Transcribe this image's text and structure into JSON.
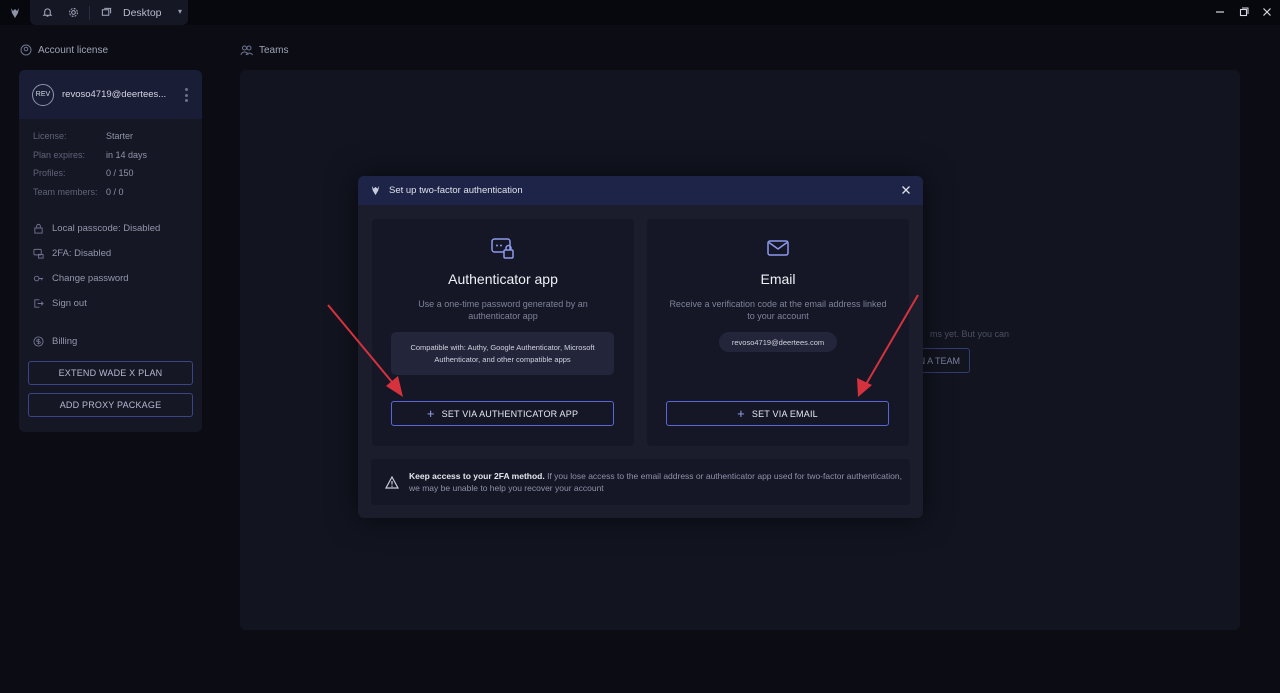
{
  "titlebar": {
    "workspace_label": "Desktop",
    "caret": "▾"
  },
  "sidebar": {
    "section_title": "Account license",
    "account": {
      "avatar_initials": "REV",
      "email": "revoso4719@deertees..."
    },
    "details": [
      {
        "label": "License:",
        "value": "Starter"
      },
      {
        "label": "Plan expires:",
        "value": "in 14 days"
      },
      {
        "label": "Profiles:",
        "value": "0 / 150"
      },
      {
        "label": "Team members:",
        "value": "0 / 0"
      }
    ],
    "links": {
      "passcode": "Local passcode: Disabled",
      "twofa": "2FA: Disabled",
      "change_password": "Change password",
      "sign_out": "Sign out",
      "billing": "Billing"
    },
    "buttons": {
      "extend": "EXTEND WADE X PLAN",
      "proxy": "ADD PROXY PACKAGE"
    }
  },
  "teams": {
    "section_title": "Teams",
    "bg_text": "ms yet. But you can",
    "bg_button": "N A TEAM"
  },
  "modal": {
    "title": "Set up two-factor authentication",
    "auth_app": {
      "title": "Authenticator app",
      "description": "Use a one-time password generated by an authenticator app",
      "compat": "Compatible with: Authy, Google Authenticator, Microsoft Authenticator, and other compatible apps",
      "button": "SET VIA AUTHENTICATOR APP"
    },
    "email": {
      "title": "Email",
      "description": "Receive a verification code at the email address linked to your account",
      "address": "revoso4719@deertees.com",
      "button": "SET VIA EMAIL"
    },
    "warning": {
      "bold": "Keep access to your 2FA method.",
      "text": " If you lose access to the email address or authenticator app used for two-factor authentication, we may be unable to help you recover your account"
    }
  },
  "colors": {
    "background": "#0c0d14",
    "panel": "#151725",
    "accent": "#5a66d8",
    "arrow": "#d6323e"
  }
}
